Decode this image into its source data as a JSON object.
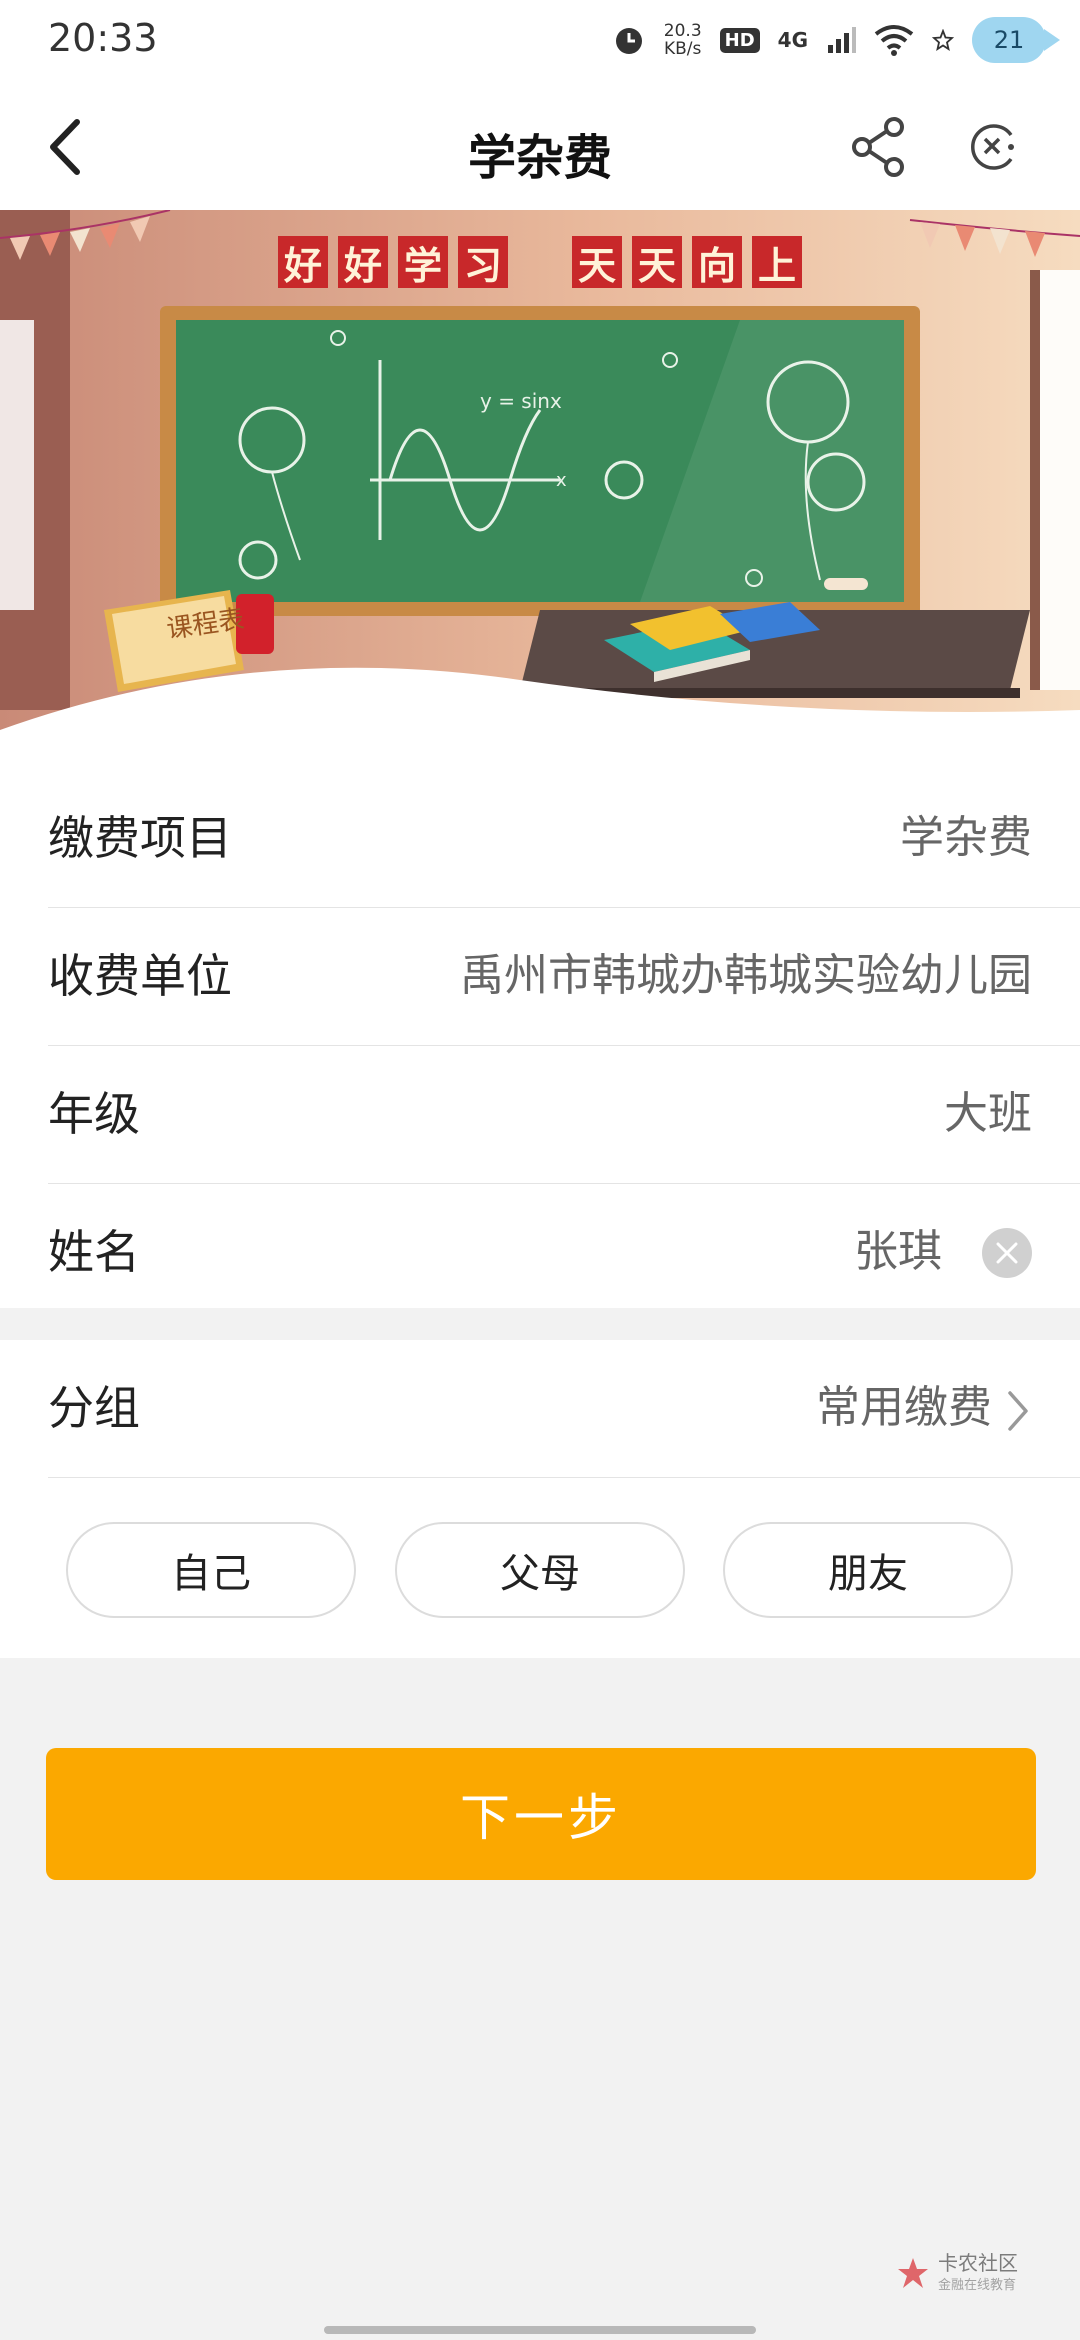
{
  "status_bar": {
    "time": "20:33",
    "speed_value": "20.3",
    "speed_unit": "KB/s",
    "hd": "HD",
    "network": "4G",
    "battery": "21"
  },
  "nav": {
    "title": "学杂费",
    "back_icon": "back-arrow-icon",
    "share_icon": "share-icon",
    "close_icon": "close-mini-program-icon"
  },
  "banner": {
    "slogan_left": [
      "好",
      "好",
      "学",
      "习"
    ],
    "slogan_right": [
      "天",
      "天",
      "向",
      "上"
    ],
    "timetable_label": "课程表",
    "formula": "y = sinx",
    "axis_label": "x"
  },
  "form": {
    "rows": [
      {
        "label": "缴费项目",
        "value": "学杂费"
      },
      {
        "label": "收费单位",
        "value": "禹州市韩城办韩城实验幼儿园"
      },
      {
        "label": "年级",
        "value": "大班"
      },
      {
        "label": "姓名",
        "value": "张琪"
      }
    ]
  },
  "group": {
    "label": "分组",
    "value": "常用缴费",
    "chips": [
      "自己",
      "父母",
      "朋友"
    ]
  },
  "next_button": "下一步",
  "watermark": {
    "title": "卡农社区",
    "subtitle": "金融在线教育"
  },
  "colors": {
    "accent": "#fba800",
    "chalkboard": "#3a8a5a",
    "slogan_bg": "#c8282a"
  }
}
